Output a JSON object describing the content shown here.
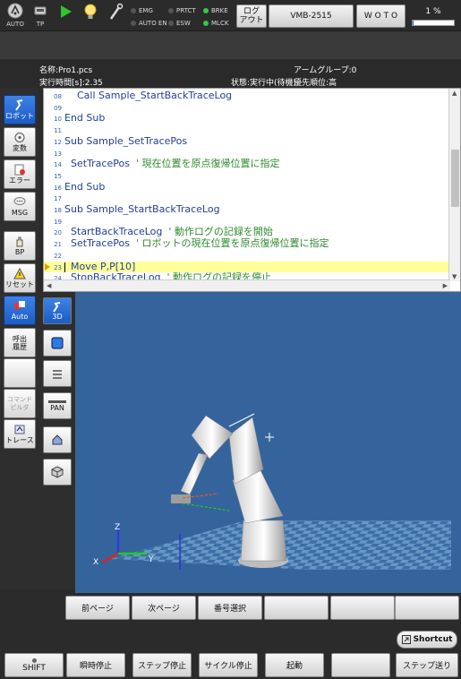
{
  "topbar": {
    "auto_label": "AUTO",
    "tp_label": "TP",
    "lamps": [
      {
        "label": "EMG",
        "on": false
      },
      {
        "label": "AUTO EN",
        "on": false
      },
      {
        "label": "PRTCT",
        "on": false
      },
      {
        "label": "ESW",
        "on": false
      },
      {
        "label": "BRKE",
        "on": true
      },
      {
        "label": "MLCK",
        "on": true
      }
    ],
    "logout_label": "ログ\nアウト",
    "robot_model": "VMB-2515",
    "woto_label": "W O T O",
    "speed": "1 %",
    "speed_fraction": 0.01
  },
  "info": {
    "name": "名称:Pro1.pcs",
    "arm_group": "アームグループ:0",
    "run_time": "実行時間[s]:2.35",
    "state": "状態:実行中(待機)",
    "priority": "優先順位:高"
  },
  "editor": {
    "lines": [
      {
        "num": "08",
        "code": "    Call Sample_StartBackTraceLog",
        "comment": "",
        "hl": false
      },
      {
        "num": "09",
        "code": "",
        "comment": "",
        "hl": false
      },
      {
        "num": "10",
        "code": "End Sub",
        "comment": "",
        "hl": false
      },
      {
        "num": "11",
        "code": "",
        "comment": "",
        "hl": false
      },
      {
        "num": "12",
        "code": "Sub Sample_SetTracePos",
        "comment": "",
        "hl": false
      },
      {
        "num": "13",
        "code": "",
        "comment": "",
        "hl": false
      },
      {
        "num": "14",
        "code": "  SetTracePos  ",
        "comment": "' 現在位置を原点復帰位置に指定",
        "hl": false
      },
      {
        "num": "15",
        "code": "",
        "comment": "",
        "hl": false
      },
      {
        "num": "16",
        "code": "End Sub",
        "comment": "",
        "hl": false
      },
      {
        "num": "17",
        "code": "",
        "comment": "",
        "hl": false
      },
      {
        "num": "18",
        "code": "Sub Sample_StartBackTraceLog",
        "comment": "",
        "hl": false
      },
      {
        "num": "19",
        "code": "",
        "comment": "",
        "hl": false
      },
      {
        "num": "20",
        "code": "  StartBackTraceLog  ",
        "comment": "' 動作ログの記録を開始",
        "hl": false
      },
      {
        "num": "21",
        "code": "  SetTracePos  ",
        "comment": "' ロボットの現在位置を原点復帰位置に指定",
        "hl": false
      },
      {
        "num": "22",
        "code": "",
        "comment": "",
        "hl": false
      },
      {
        "num": "23",
        "code": "  Move P,P[10]",
        "comment": "",
        "hl": true
      },
      {
        "num": "24",
        "code": "  StopBackTraceLog  ",
        "comment": "' 動作ログの記録を停止",
        "hl": false
      }
    ]
  },
  "left_menu": [
    {
      "label": "ロボット",
      "icon": "robot-icon",
      "selected": true
    },
    {
      "label": "変数",
      "icon": "variable-icon",
      "selected": false
    },
    {
      "label": "エラー",
      "icon": "error-icon",
      "selected": false
    },
    {
      "label": "MSG",
      "icon": "message-icon",
      "selected": false
    },
    {
      "label": "BP",
      "icon": "hand-icon",
      "selected": false
    },
    {
      "label": "リセット",
      "icon": "warning-icon",
      "selected": false
    },
    {
      "label": "Auto",
      "icon": "auto-icon",
      "selected": true
    },
    {
      "label": "呼出\n履歴",
      "icon": "",
      "selected": false
    },
    {
      "label": "",
      "icon": "",
      "selected": false
    },
    {
      "label": "コマンド\nビルダ",
      "icon": "",
      "selected": false
    },
    {
      "label": "トレース",
      "icon": "trace-icon",
      "selected": false
    }
  ],
  "view_menu": [
    {
      "label": "3D",
      "icon": "robot-3d-icon",
      "selected": true
    },
    {
      "label": "",
      "icon": "square-icon",
      "selected": false
    },
    {
      "label": "",
      "icon": "layers-icon",
      "selected": false
    },
    {
      "label": "PAN",
      "icon": "pan-icon",
      "selected": false
    },
    {
      "label": "",
      "icon": "home-icon",
      "selected": false
    },
    {
      "label": "",
      "icon": "cube-icon",
      "selected": false
    }
  ],
  "axes": {
    "x": "X",
    "y": "Y",
    "z": "Z"
  },
  "page_buttons": [
    "前ページ",
    "次ページ",
    "番号選択",
    "",
    "",
    ""
  ],
  "shortcut_label": "Shortcut",
  "bottom_buttons": [
    "SHIFT",
    "瞬時停止",
    "ステップ停止",
    "サイクル停止",
    "起動",
    "",
    "ステップ送り"
  ],
  "colors": {
    "accent_blue": "#2a6bd6",
    "highlight": "#ffff99",
    "code": "#1f3f9c",
    "comment": "#2e8b2e",
    "viewport": "#35649c"
  }
}
